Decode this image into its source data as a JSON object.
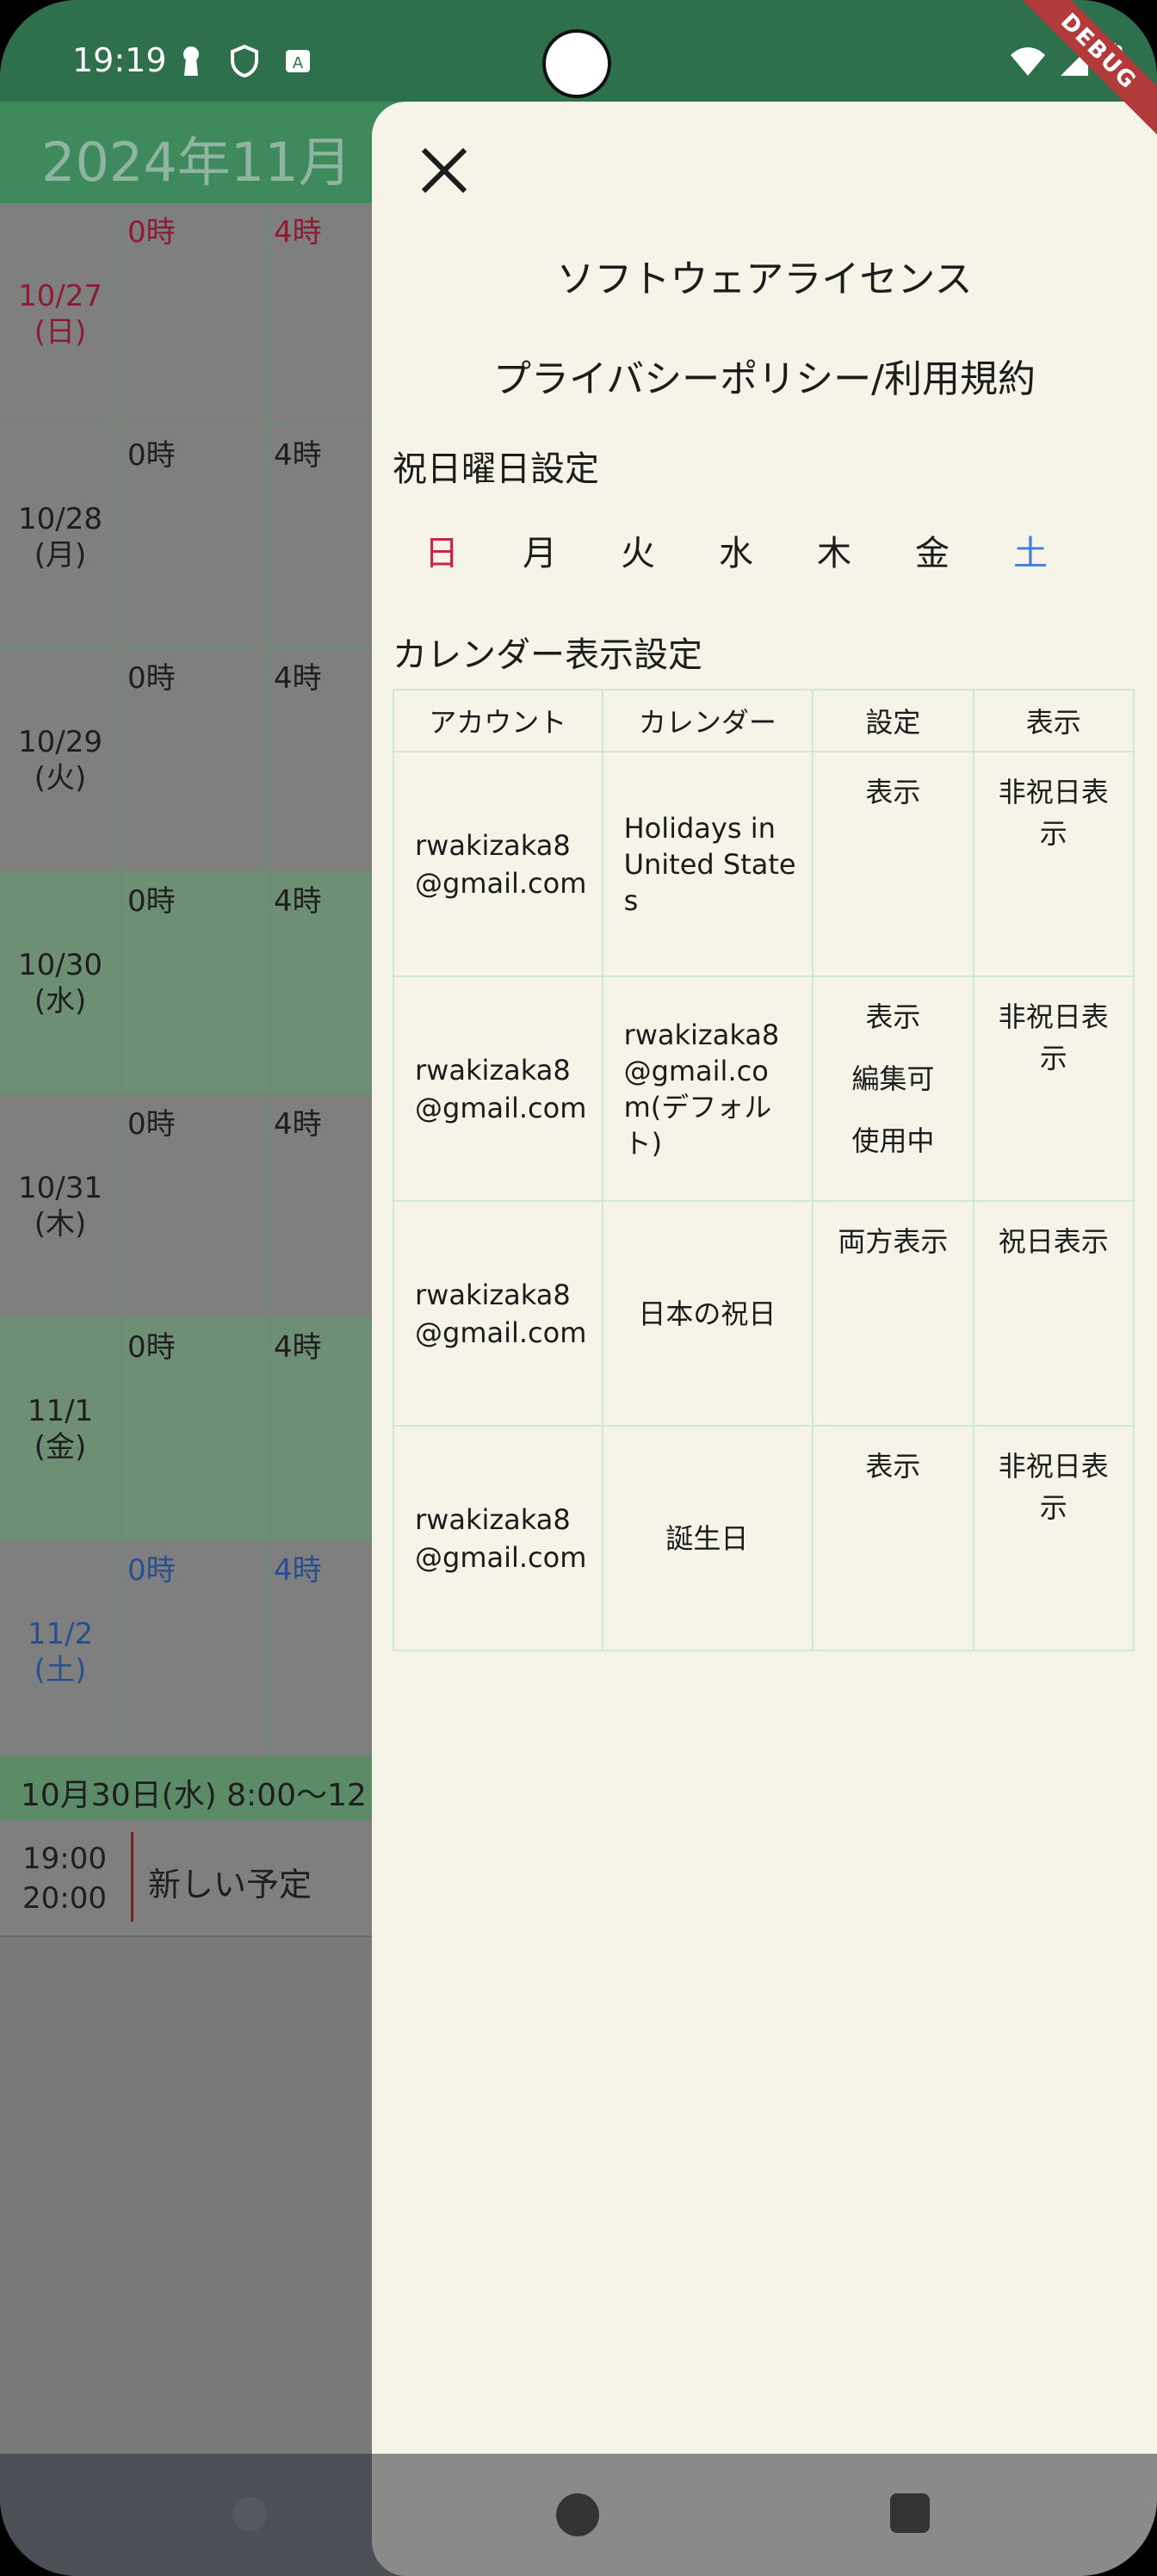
{
  "status_bar": {
    "time": "19:19",
    "debug_label": "DEBUG"
  },
  "calendar": {
    "month_title": "2024年11月",
    "days": [
      {
        "date": "10/27\n(日)",
        "color": "red",
        "h0": "0時",
        "h4": "4時"
      },
      {
        "date": "10/28\n(月)",
        "color": "normal",
        "h0": "0時",
        "h4": "4時"
      },
      {
        "date": "10/29\n(火)",
        "color": "normal",
        "h0": "0時",
        "h4": "4時"
      },
      {
        "date": "10/30\n(水)",
        "color": "normal",
        "h0": "0時",
        "h4": "4時"
      },
      {
        "date": "10/31\n(木)",
        "color": "normal",
        "h0": "0時",
        "h4": "4時"
      },
      {
        "date": "11/1\n(金)",
        "color": "normal",
        "h0": "0時",
        "h4": "4時"
      },
      {
        "date": "11/2\n(土)",
        "color": "blue",
        "h0": "0時",
        "h4": "4時"
      }
    ],
    "event_header": "10月30日(水) 8:00〜12",
    "event": {
      "start": "19:00",
      "end": "20:00",
      "title": "新しい予定"
    }
  },
  "drawer": {
    "software_license": "ソフトウェアライセンス",
    "privacy_terms": "プライバシーポリシー/利用規約",
    "holiday_weekday_title": "祝日曜日設定",
    "weekdays": [
      "日",
      "月",
      "火",
      "水",
      "木",
      "金",
      "土"
    ],
    "calendar_display_title": "カレンダー表示設定",
    "table": {
      "headers": [
        "アカウント",
        "カレンダー",
        "設定",
        "表示"
      ],
      "rows": [
        {
          "account": "rwakizaka8\n@gmail.com",
          "calendar": "Holidays in\nUnited State\ns",
          "settings": [
            "表示"
          ],
          "display": "非祝日表\n示"
        },
        {
          "account": "rwakizaka8\n@gmail.com",
          "calendar": "rwakizaka8\n@gmail.co\nm(デフォル\nト)",
          "settings": [
            "表示",
            "編集可",
            "使用中"
          ],
          "display": "非祝日表\n示"
        },
        {
          "account": "rwakizaka8\n@gmail.com",
          "calendar": "日本の祝日",
          "settings": [
            "両方表示"
          ],
          "display": "祝日表示"
        },
        {
          "account": "rwakizaka8\n@gmail.com",
          "calendar": "誕生日",
          "settings": [
            "表示"
          ],
          "display": "非祝日表\n示"
        }
      ]
    }
  },
  "colors": {
    "status_green": "#2e6f4c",
    "drawer_bg": "#f6f3e9",
    "sunday": "#c8244a",
    "saturday": "#3f7fe0",
    "table_border": "#cfe9d6"
  }
}
